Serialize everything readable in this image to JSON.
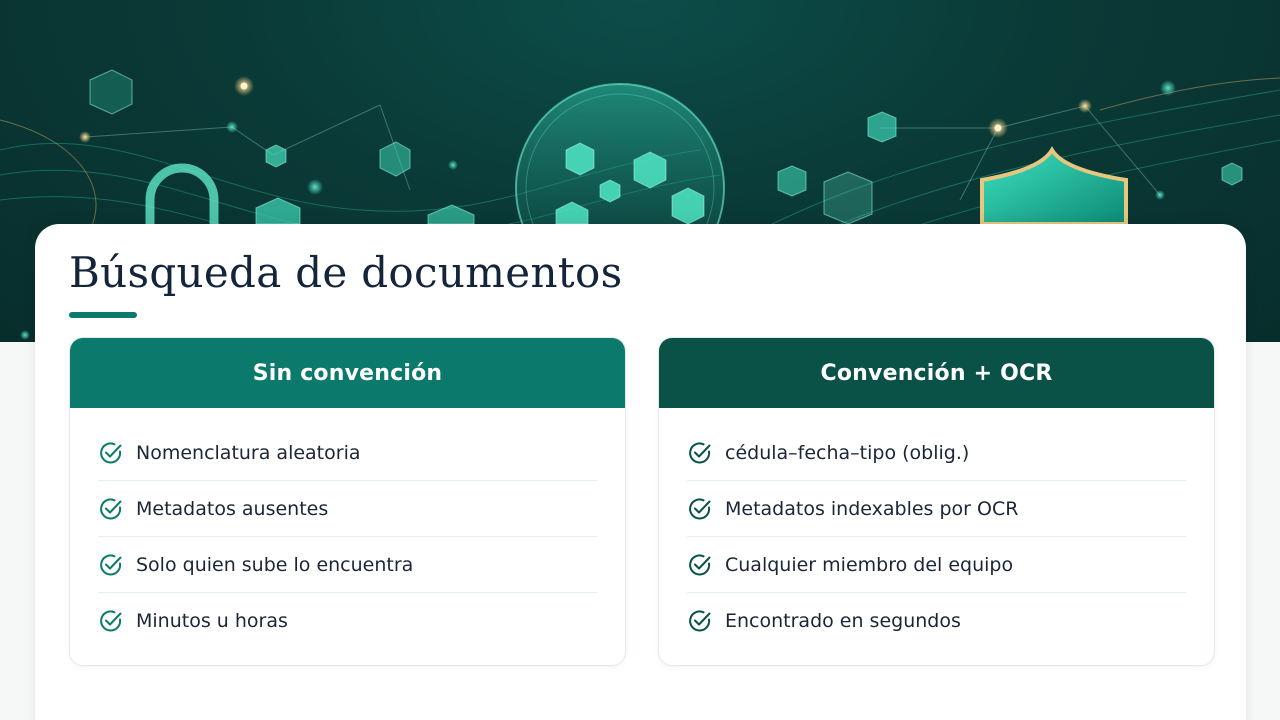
{
  "slide": {
    "title": "Búsqueda de documentos",
    "accent_color": "#0b7b6d",
    "hero_icons": [
      "padlock-icon",
      "cube-icon",
      "network-node-icon",
      "shield-icon",
      "orb-icon"
    ]
  },
  "comparison": {
    "left": {
      "heading": "Sin convención",
      "header_color": "#0b7a6c",
      "items": [
        "Nomenclatura aleatoria",
        "Metadatos ausentes",
        "Solo quien sube lo encuentra",
        "Minutos u horas"
      ]
    },
    "right": {
      "heading": "Convención + OCR",
      "header_color": "#0a5248",
      "items": [
        "cédula–fecha–tipo (oblig.)",
        "Metadatos indexables por OCR",
        "Cualquier miembro del equipo",
        "Encontrado en segundos"
      ]
    }
  }
}
